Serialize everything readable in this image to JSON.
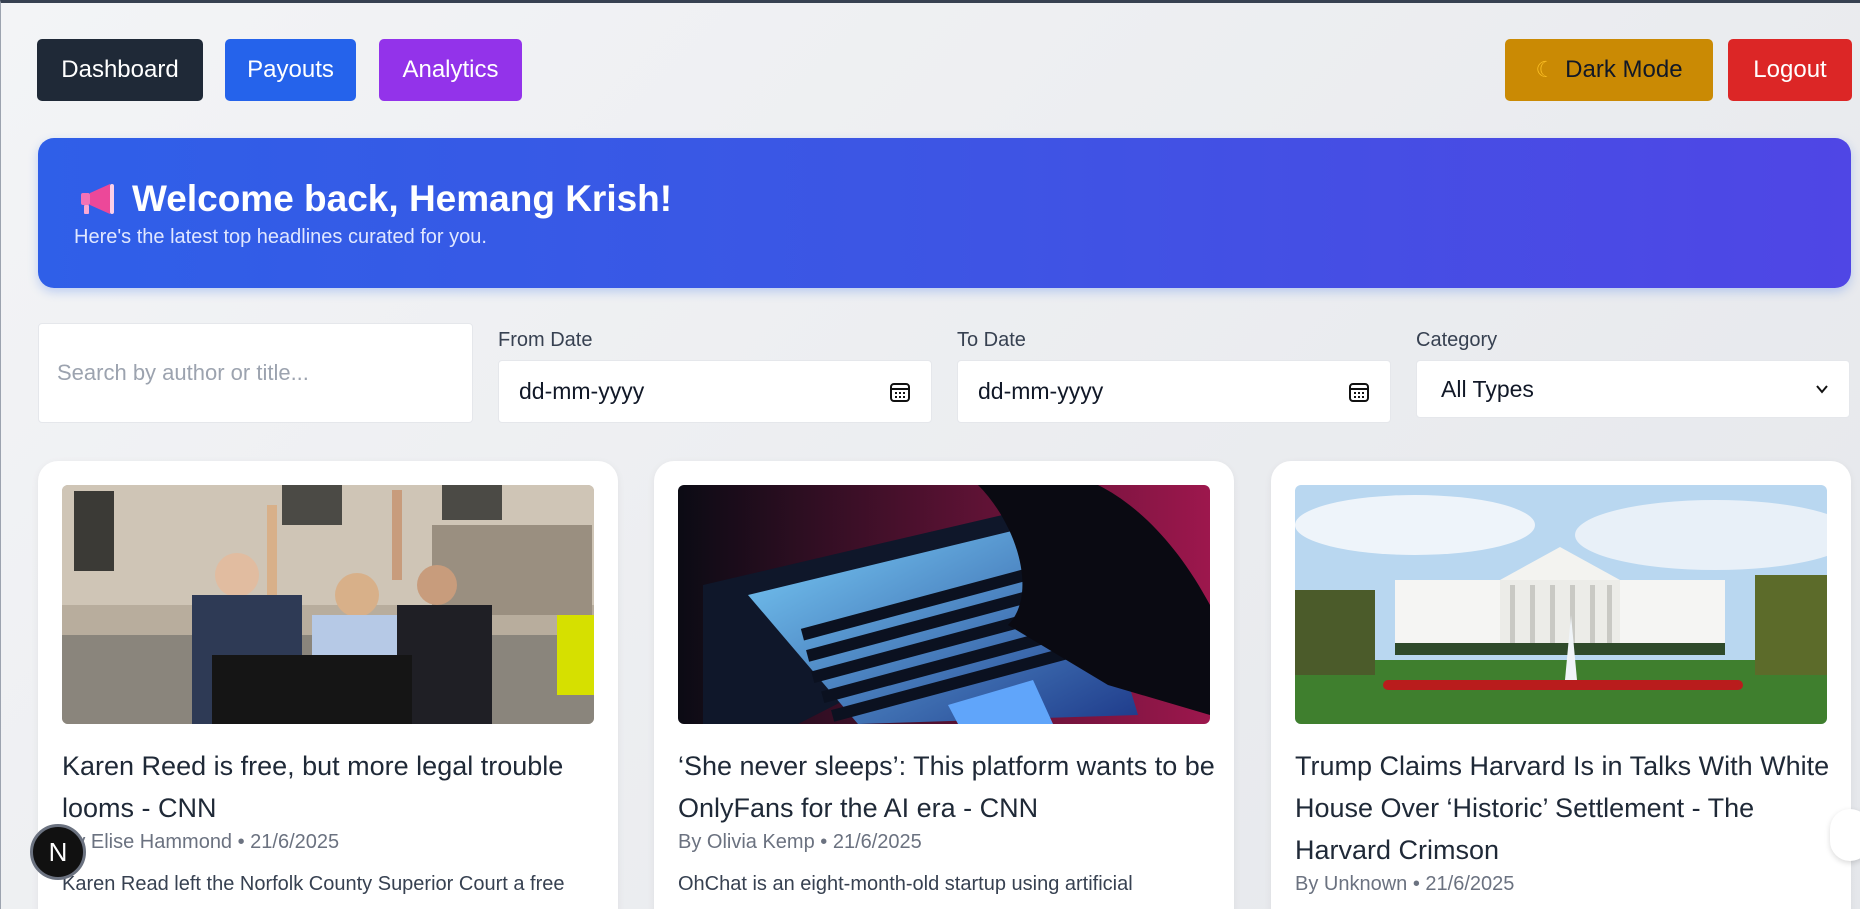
{
  "nav": {
    "dashboard": "Dashboard",
    "payouts": "Payouts",
    "analytics": "Analytics",
    "dark_mode": "Dark Mode",
    "logout": "Logout"
  },
  "banner": {
    "title": "Welcome back, Hemang Krish!",
    "subtitle": "Here's the latest top headlines curated for you."
  },
  "filters": {
    "search_placeholder": "Search by author or title...",
    "from_label": "From Date",
    "from_value": "dd-mm-yyyy",
    "to_label": "To Date",
    "to_value": "dd-mm-yyyy",
    "category_label": "Category",
    "category_value": "All Types"
  },
  "cards": [
    {
      "title": "Karen Reed is free, but more legal trouble looms - CNN",
      "meta": "By Elise Hammond • 21/6/2025",
      "desc": "Karen Read left the Norfolk County Superior Court a free"
    },
    {
      "title": "‘She never sleeps’: This platform wants to be OnlyFans for the AI era - CNN",
      "meta": "By Olivia Kemp • 21/6/2025",
      "desc": "OhChat is an eight-month-old startup using artificial"
    },
    {
      "title": "Trump Claims Harvard Is in Talks With White House Over ‘Historic’ Settlement - The Harvard Crimson",
      "meta": "By Unknown • 21/6/2025",
      "desc": ""
    }
  ],
  "avatar_letter": "N",
  "colors": {
    "dashboard": "#1f2937",
    "payouts": "#2563eb",
    "analytics": "#9333ea",
    "dark_mode": "#ca8a04",
    "logout": "#dc2626",
    "banner_start": "#2f5fe8",
    "banner_end": "#4f46e5"
  }
}
